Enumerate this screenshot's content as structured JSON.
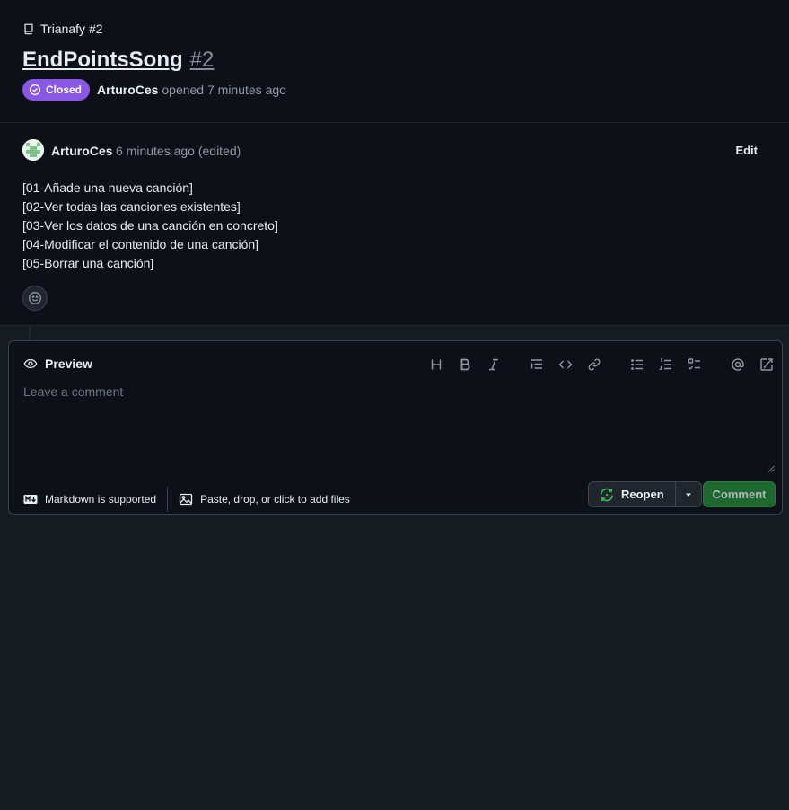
{
  "breadcrumb": {
    "repo_label": "Trianafy #2"
  },
  "issue": {
    "title": "EndPointsSong",
    "number": "#2",
    "state_label": "Closed",
    "author": "ArturoCes",
    "opened_text": "opened 7 minutes ago"
  },
  "comment": {
    "author": "ArturoCes",
    "time": "6 minutes ago (edited)",
    "edit_label": "Edit",
    "lines": [
      "[01-Añade una nueva canción]",
      "[02-Ver todas las canciones existentes]",
      "[03-Ver los datos de una canción en concreto]",
      "[04-Modificar el contenido de una canción]",
      "[05-Borrar una canción]"
    ]
  },
  "editor": {
    "preview_label": "Preview",
    "placeholder": "Leave a comment",
    "markdown_label": "Markdown is supported",
    "attach_label": "Paste, drop, or click to add files",
    "reopen_label": "Reopen",
    "comment_label": "Comment",
    "toolbar": [
      "heading-icon",
      "bold-icon",
      "italic-icon",
      "quote-icon",
      "code-icon",
      "link-icon",
      "unordered-list-icon",
      "ordered-list-icon",
      "task-list-icon",
      "mention-icon",
      "reference-icon"
    ]
  },
  "colors": {
    "closed_badge": "#8957e5",
    "comment_button": "#238636",
    "reopen_icon": "#3fb950",
    "page_bg": "#161b22",
    "panel_bg": "#0d1117"
  }
}
